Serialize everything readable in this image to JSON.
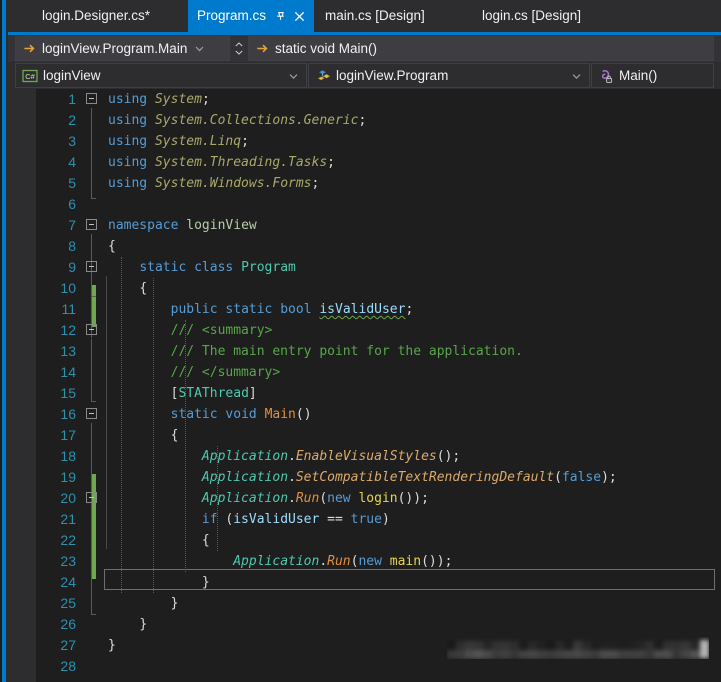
{
  "window": {
    "theme": "visual-studio-dark",
    "accent_color": "#007acc",
    "editor_bg": "#1e1e1e",
    "chrome_bg": "#2d2d30"
  },
  "tabs": {
    "items": [
      {
        "label": "login.Designer.cs*",
        "active": false,
        "modified": true
      },
      {
        "label": "Program.cs",
        "active": true,
        "modified": false
      },
      {
        "label": "main.cs [Design]",
        "active": false,
        "modified": false
      },
      {
        "label": "login.cs [Design]",
        "active": false,
        "modified": false
      }
    ],
    "pin_icon": "pin-icon",
    "close_icon": "close-icon"
  },
  "breadcrumb": {
    "scope": {
      "icon": "arrow-right-icon",
      "label": "loginView.Program.Main",
      "caret_icon": "chevron-down-icon"
    },
    "signature": {
      "icon": "arrow-right-icon",
      "label": "static void Main()"
    },
    "spinner": {
      "up_icon": "chevron-up-icon",
      "down_icon": "chevron-down-icon"
    }
  },
  "scope_bar": {
    "project": {
      "icon": "csharp-project-icon",
      "icon_text": "C#",
      "label": "loginView",
      "caret_icon": "chevron-down-icon"
    },
    "type": {
      "icon": "class-icon",
      "label": "loginView.Program",
      "caret_icon": "chevron-down-icon"
    },
    "member": {
      "icon": "method-private-icon",
      "label": "Main()"
    }
  },
  "editor": {
    "language": "csharp",
    "current_line": 20,
    "line_count": 28,
    "lines": [
      {
        "n": 1,
        "text": "using System;"
      },
      {
        "n": 2,
        "text": "using System.Collections.Generic;"
      },
      {
        "n": 3,
        "text": "using System.Linq;"
      },
      {
        "n": 4,
        "text": "using System.Threading.Tasks;"
      },
      {
        "n": 5,
        "text": "using System.Windows.Forms;"
      },
      {
        "n": 6,
        "text": ""
      },
      {
        "n": 7,
        "text": "namespace loginView"
      },
      {
        "n": 8,
        "text": "{"
      },
      {
        "n": 9,
        "text": "    static class Program"
      },
      {
        "n": 10,
        "text": "    {"
      },
      {
        "n": 11,
        "text": "        public static bool isValidUser;"
      },
      {
        "n": 12,
        "text": "        /// <summary>"
      },
      {
        "n": 13,
        "text": "        /// The main entry point for the application."
      },
      {
        "n": 14,
        "text": "        /// </summary>"
      },
      {
        "n": 15,
        "text": "        [STAThread]"
      },
      {
        "n": 16,
        "text": "        static void Main()"
      },
      {
        "n": 17,
        "text": "        {"
      },
      {
        "n": 18,
        "text": "            Application.EnableVisualStyles();"
      },
      {
        "n": 19,
        "text": "            Application.SetCompatibleTextRenderingDefault(false);"
      },
      {
        "n": 20,
        "text": "            Application.Run(new login());"
      },
      {
        "n": 21,
        "text": "            if (isValidUser == true)"
      },
      {
        "n": 22,
        "text": "            {"
      },
      {
        "n": 23,
        "text": "                Application.Run(new main());"
      },
      {
        "n": 24,
        "text": "            }"
      },
      {
        "n": 25,
        "text": "        }"
      },
      {
        "n": 26,
        "text": "    }"
      },
      {
        "n": 27,
        "text": "}"
      },
      {
        "n": 28,
        "text": ""
      }
    ],
    "diagnostics": [
      {
        "line": 11,
        "token": "isValidUser",
        "severity": "suggestion",
        "underline_color": "#6ea84f"
      }
    ],
    "change_bars": [
      {
        "from_line": 10,
        "to_line": 11,
        "color": "#6ea84f"
      },
      {
        "from_line": 20,
        "to_line": 24,
        "color": "#6ea84f"
      }
    ],
    "fold_markers": [
      1,
      7,
      9,
      12,
      16,
      21
    ],
    "colors": {
      "line_number": "#2b91af",
      "keyword": "#569cd6",
      "comment": "#57a64a",
      "type": "#4ec9b0",
      "method": "#dcaa6b",
      "namespace_using": "#a9a96a",
      "class_literal": "#e8d44d",
      "plain": "#dcdcdc"
    }
  },
  "overlay": {
    "redacted_block": "blurred-region"
  }
}
